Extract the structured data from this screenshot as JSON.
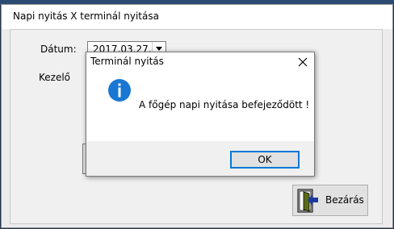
{
  "main_window": {
    "title": "Napi nyitás X terminál nyitása",
    "date_label": "Dátum:",
    "date_value": "2017.03.27.",
    "operator_label": "Kezelő",
    "close_button_label": "Bezárás"
  },
  "dialog": {
    "title": "Terminál nyitás",
    "message": "A főgép napi nyitása befejeződött !",
    "ok_label": "OK"
  },
  "colors": {
    "info_icon": "#1976d2",
    "focus_border": "#0078d7",
    "desktop": "#24364f"
  },
  "icons": {
    "dialog_close": "close-icon",
    "message_type": "info-icon",
    "combo": "chevron-down-icon",
    "exit": "exit-door-icon"
  }
}
